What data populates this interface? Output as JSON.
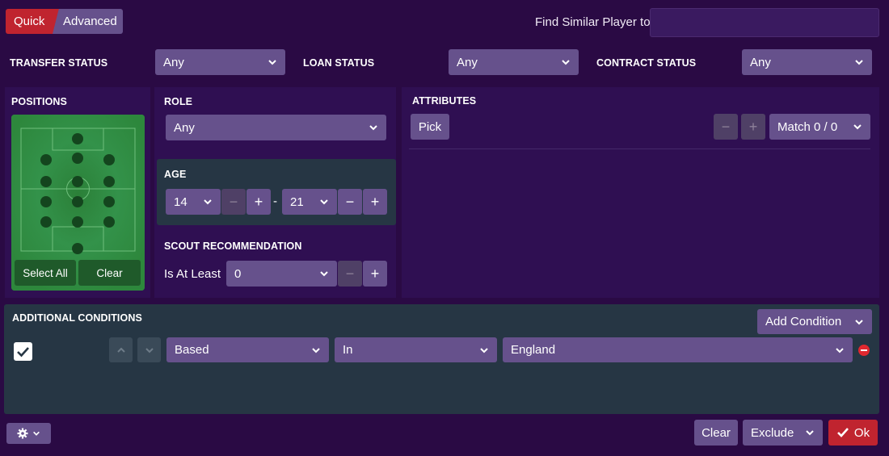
{
  "mode_toggle": {
    "quick": "Quick",
    "advanced": "Advanced"
  },
  "find_similar": {
    "label": "Find Similar Player to",
    "value": ""
  },
  "filters": {
    "transfer_status": {
      "label": "TRANSFER STATUS",
      "value": "Any"
    },
    "loan_status": {
      "label": "LOAN STATUS",
      "value": "Any"
    },
    "contract_status": {
      "label": "CONTRACT STATUS",
      "value": "Any"
    }
  },
  "positions": {
    "label": "POSITIONS",
    "select_all": "Select All",
    "clear": "Clear"
  },
  "role": {
    "label": "ROLE",
    "value": "Any"
  },
  "age": {
    "label": "AGE",
    "min": "14",
    "separator": "-",
    "max": "21"
  },
  "scout": {
    "label": "SCOUT RECOMMENDATION",
    "qualifier": "Is At Least",
    "value": "0"
  },
  "attributes": {
    "label": "ATTRIBUTES",
    "pick": "Pick",
    "match": "Match 0 / 0"
  },
  "additional": {
    "label": "ADDITIONAL CONDITIONS",
    "add_condition": "Add Condition",
    "condition": {
      "field": "Based",
      "operator": "In",
      "value": "England",
      "checked": true
    }
  },
  "footer": {
    "clear": "Clear",
    "exclude": "Exclude",
    "ok": "Ok"
  },
  "colors": {
    "background": "#2a0a44",
    "panel": "#2f0f52",
    "control": "#66518c",
    "accent_red": "#c0242f",
    "pitch_green": "#2e8a3c",
    "dark_panel": "#263644"
  }
}
